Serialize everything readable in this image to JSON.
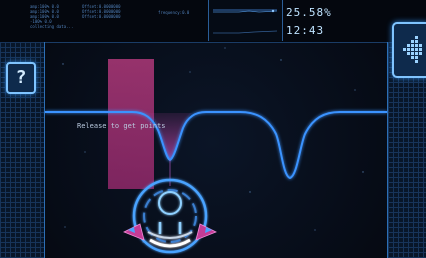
{
  "hud": {
    "stats_left": "amp:100% 0.0\namp:100% 0.0\namp:100% 0.0\n-100% 0.0\ncollecting data...",
    "stats_mid": "Offset:0.0000000\nOffset:0.0000000\nOffset:0.0000000",
    "frequency": "frequency:0.0",
    "percent": "25.58%",
    "clock": "12:43"
  },
  "help_button": {
    "label": "?"
  },
  "playfield": {
    "hint": "Release to get points"
  },
  "colors": {
    "accent": "#4aa3ff",
    "target": "#c43c86",
    "wave": "#3b93ff",
    "panel_border": "#2c6fb5"
  },
  "icons": {
    "back": "chevron-left-arrow-icon",
    "help": "question-mark-icon",
    "cannon": "circular-launcher-icon"
  }
}
